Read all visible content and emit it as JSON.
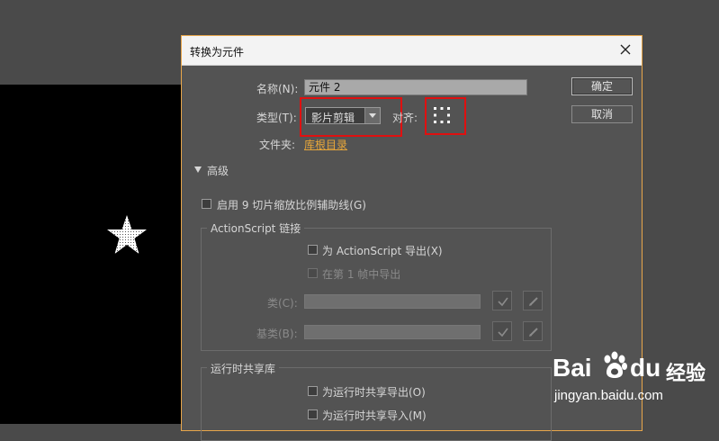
{
  "dialog": {
    "title": "转换为元件",
    "name_label": "名称(N):",
    "name_value": "元件 2",
    "type_label": "类型(T):",
    "type_value": "影片剪辑",
    "align_label": "对齐:",
    "folder_label": "文件夹:",
    "folder_link": "库根目录",
    "ok_label": "确定",
    "cancel_label": "取消",
    "advanced_label": "高级",
    "nine_slice_label": "启用 9 切片缩放比例辅助线(G)",
    "actionscript": {
      "group_title": "ActionScript 链接",
      "export_label": "为 ActionScript 导出(X)",
      "export_frame_label": "在第 1 帧中导出",
      "class_label": "类(C):",
      "base_class_label": "基类(B):"
    },
    "runtime": {
      "group_title": "运行时共享库",
      "export_label": "为运行时共享导出(O)",
      "import_label": "为运行时共享导入(M)"
    }
  },
  "watermark": {
    "brand": "Bai",
    "brand2": "du",
    "suffix": "经验",
    "url": "jingyan.baidu.com"
  },
  "colors": {
    "accent_link": "#e8a73a",
    "highlight_box": "#e01010",
    "dialog_border": "#e8a64a"
  }
}
